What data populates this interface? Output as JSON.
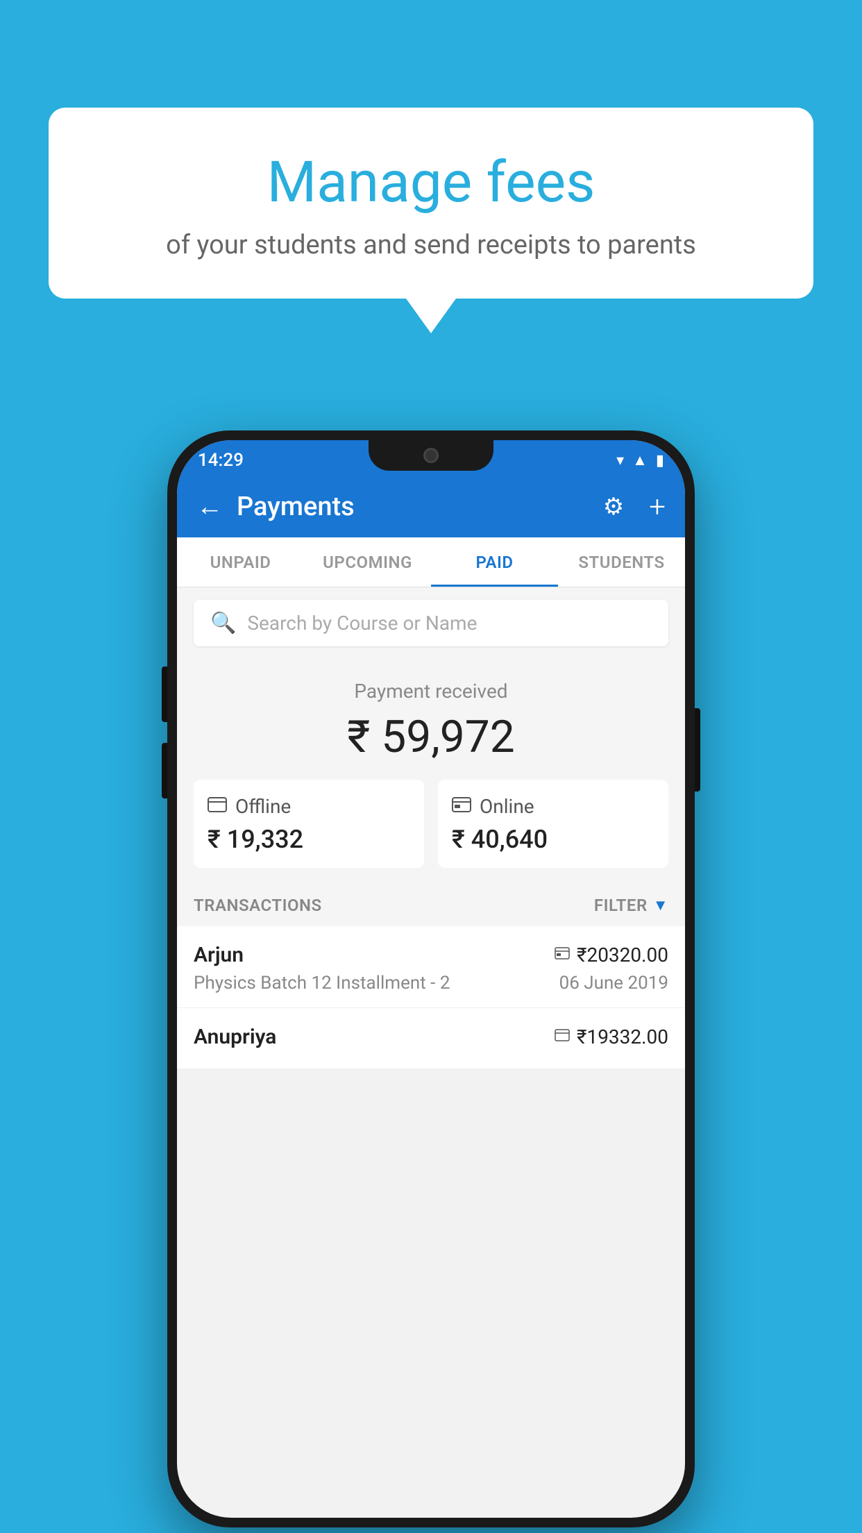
{
  "background_color": "#29AEDE",
  "speech_bubble": {
    "title": "Manage fees",
    "subtitle": "of your students and send receipts to parents"
  },
  "status_bar": {
    "time": "14:29",
    "icons": [
      "wifi",
      "signal",
      "battery"
    ]
  },
  "header": {
    "title": "Payments",
    "back_label": "←",
    "gear_label": "⚙",
    "plus_label": "+"
  },
  "tabs": [
    {
      "label": "UNPAID",
      "active": false
    },
    {
      "label": "UPCOMING",
      "active": false
    },
    {
      "label": "PAID",
      "active": true
    },
    {
      "label": "STUDENTS",
      "active": false
    }
  ],
  "search": {
    "placeholder": "Search by Course or Name"
  },
  "payment_received": {
    "label": "Payment received",
    "amount": "₹ 59,972",
    "cards": [
      {
        "icon": "offline",
        "label": "Offline",
        "amount": "₹ 19,332"
      },
      {
        "icon": "online",
        "label": "Online",
        "amount": "₹ 40,640"
      }
    ]
  },
  "transactions": {
    "label": "TRANSACTIONS",
    "filter_label": "FILTER",
    "rows": [
      {
        "name": "Arjun",
        "amount": "₹20320.00",
        "payment_type": "online",
        "course": "Physics Batch 12 Installment - 2",
        "date": "06 June 2019"
      },
      {
        "name": "Anupriya",
        "amount": "₹19332.00",
        "payment_type": "offline",
        "course": "",
        "date": ""
      }
    ]
  }
}
